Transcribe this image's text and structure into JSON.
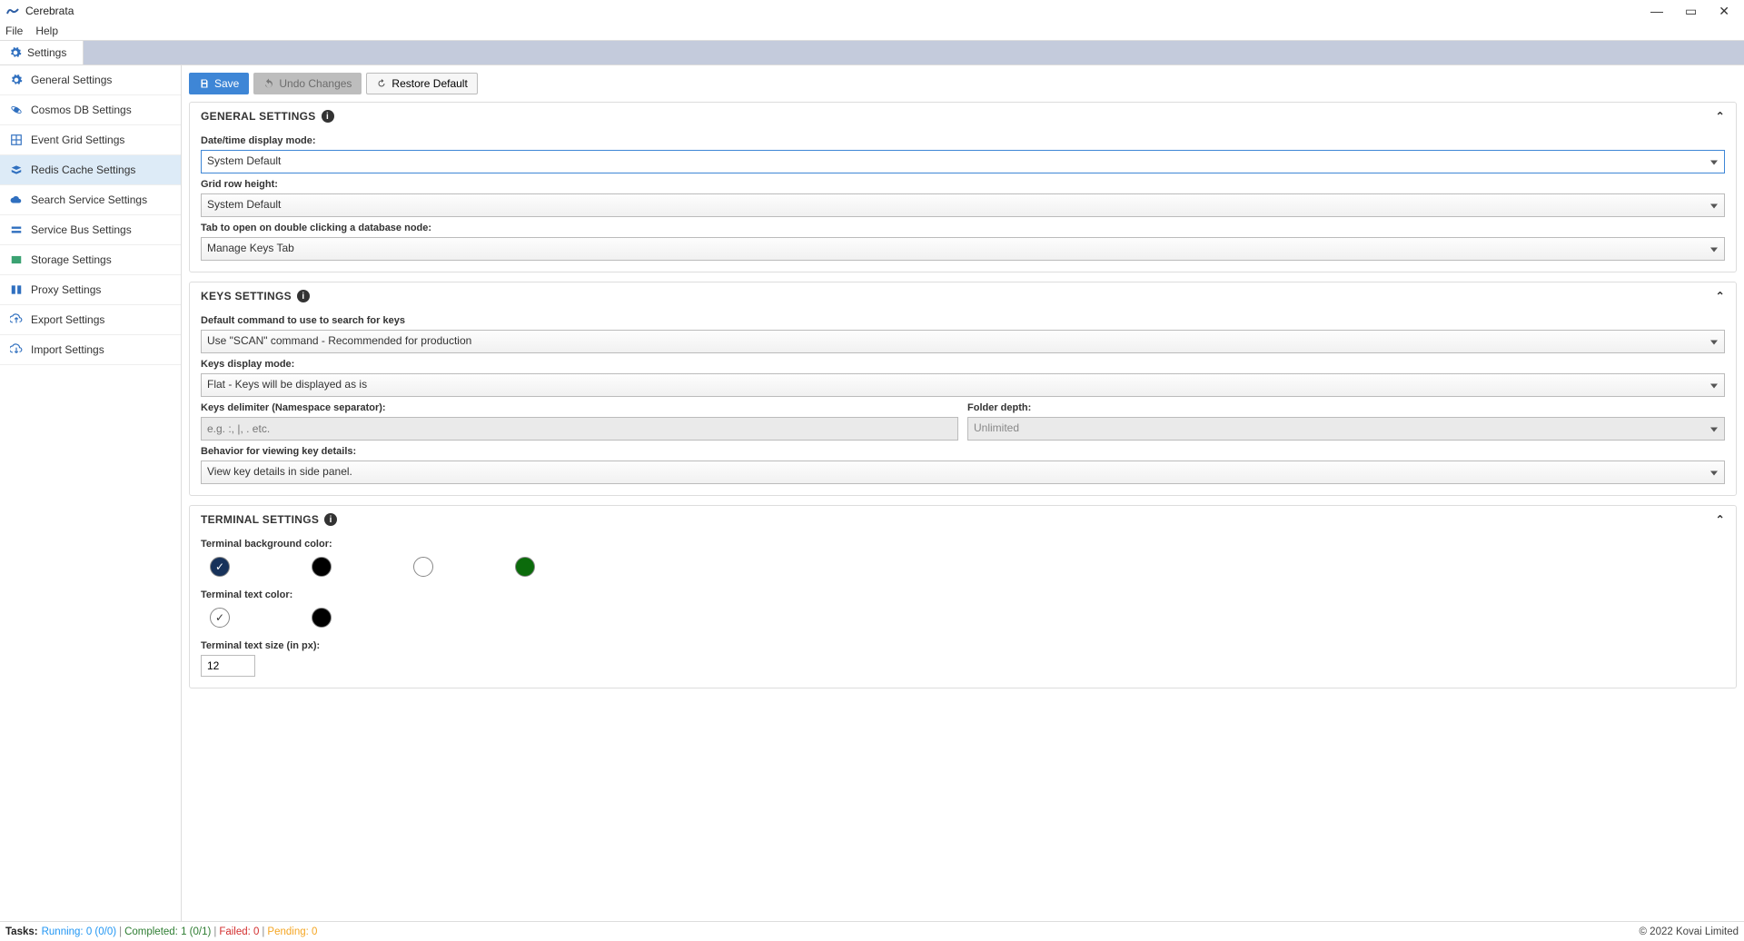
{
  "app": {
    "title": "Cerebrata"
  },
  "menu": {
    "file": "File",
    "help": "Help"
  },
  "tab": {
    "settings": "Settings"
  },
  "sidebar": {
    "general": "General Settings",
    "cosmos": "Cosmos DB Settings",
    "eventgrid": "Event Grid Settings",
    "redis": "Redis Cache Settings",
    "search": "Search Service Settings",
    "servicebus": "Service Bus Settings",
    "storage": "Storage Settings",
    "proxy": "Proxy Settings",
    "export": "Export Settings",
    "import": "Import Settings"
  },
  "toolbar": {
    "save": "Save",
    "undo": "Undo Changes",
    "restore": "Restore Default"
  },
  "general_section": {
    "title": "GENERAL SETTINGS",
    "datetime_label": "Date/time display mode:",
    "datetime_value": "System Default",
    "rowheight_label": "Grid row height:",
    "rowheight_value": "System Default",
    "dbtab_label": "Tab to open on double clicking a database node:",
    "dbtab_value": "Manage Keys Tab"
  },
  "keys_section": {
    "title": "KEYS SETTINGS",
    "searchcmd_label": "Default command to use to search for keys",
    "searchcmd_value": "Use \"SCAN\" command - Recommended for production",
    "displaymode_label": "Keys display mode:",
    "displaymode_value": "Flat - Keys will be displayed as is",
    "delimiter_label": "Keys delimiter (Namespace separator):",
    "delimiter_placeholder": "e.g. :, |, . etc.",
    "folderdepth_label": "Folder depth:",
    "folderdepth_value": "Unlimited",
    "behavior_label": "Behavior for viewing key details:",
    "behavior_value": "View key details in side panel."
  },
  "terminal_section": {
    "title": "TERMINAL SETTINGS",
    "bgcolor_label": "Terminal background color:",
    "textcolor_label": "Terminal text color:",
    "textsize_label": "Terminal text size (in px):",
    "textsize_value": "12"
  },
  "status": {
    "tasks_label": "Tasks:",
    "running": "Running: 0 (0/0)",
    "completed": "Completed: 1 (0/1)",
    "failed": "Failed: 0",
    "pending": "Pending: 0",
    "copyright": "© 2022 Kovai Limited"
  }
}
